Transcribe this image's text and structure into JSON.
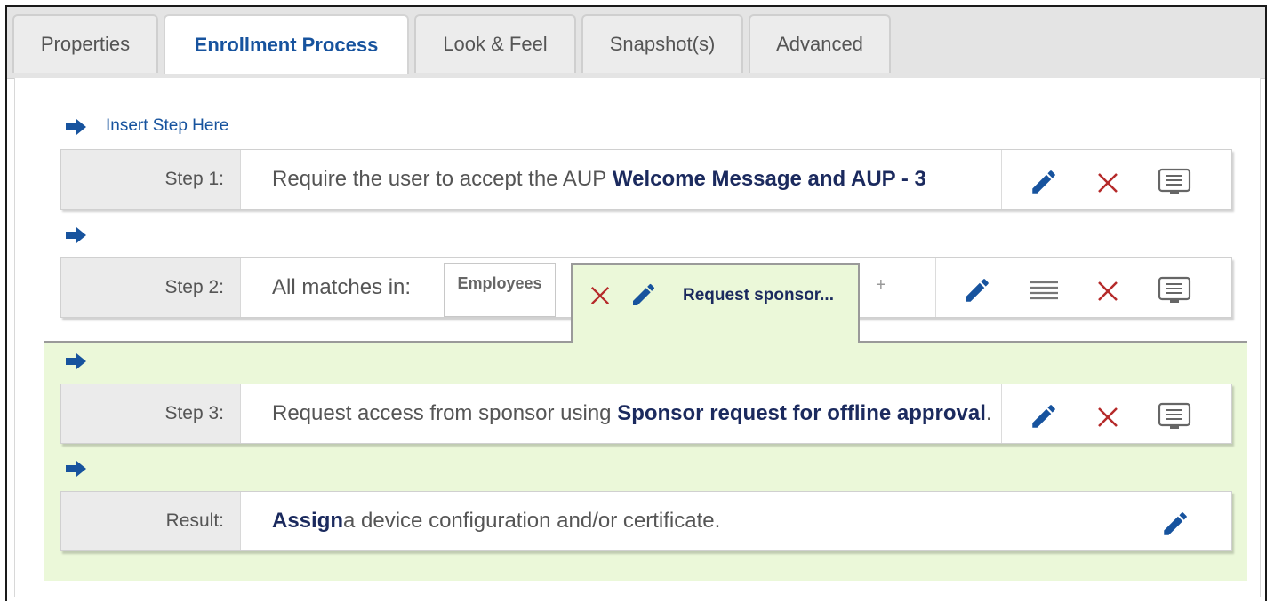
{
  "tabs": [
    {
      "label": "Properties",
      "active": false
    },
    {
      "label": "Enrollment Process",
      "active": true
    },
    {
      "label": "Look & Feel",
      "active": false
    },
    {
      "label": "Snapshot(s)",
      "active": false
    },
    {
      "label": "Advanced",
      "active": false
    }
  ],
  "insert_step_label": "Insert Step Here",
  "steps": [
    {
      "label": "Step 1:",
      "text": "Require the user to accept the AUP ",
      "bold": "Welcome Message and AUP - 3"
    },
    {
      "label": "Step 2:",
      "text": "All matches in:",
      "group": "Employees",
      "sponsor_tab": "Request sponsor...",
      "add_symbol": "+"
    },
    {
      "label": "Step 3:",
      "text": "Request access from sponsor using ",
      "bold": "Sponsor request for offline approval",
      "suffix": "."
    },
    {
      "label": "Result:",
      "bold": "Assign",
      "text": " a device configuration and/or certificate."
    }
  ],
  "colors": {
    "accent_blue": "#17539e",
    "dark_navy": "#1b2a5e",
    "delete_red": "#b52a2a",
    "green_zone": "#ebf8d9"
  },
  "icons": [
    "arrow-right-icon",
    "pencil-icon",
    "close-icon",
    "comment-icon",
    "list-icon"
  ]
}
